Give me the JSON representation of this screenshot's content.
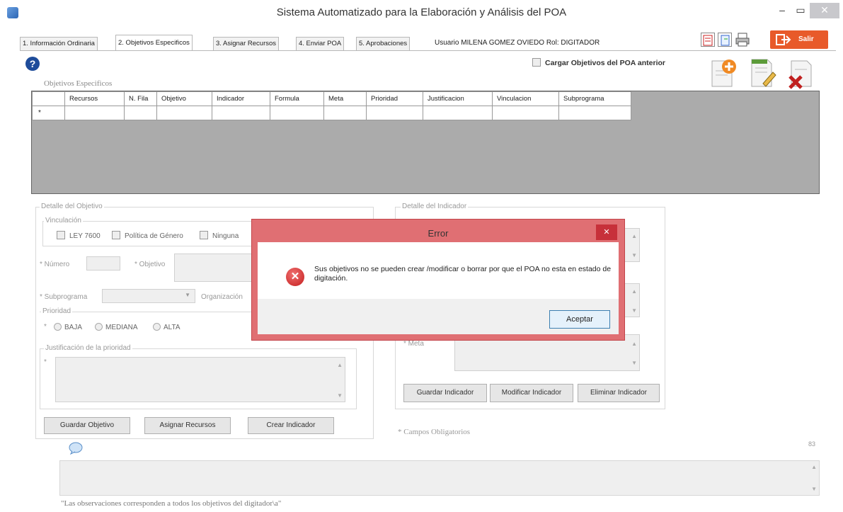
{
  "window": {
    "title": "Sistema Automatizado para la Elaboración y Análisis del POA",
    "minimize": "–",
    "maximize": "▭",
    "close": "✕"
  },
  "tabs": [
    {
      "label": "1. Información Ordinaria"
    },
    {
      "label": "2. Objetivos Especificos"
    },
    {
      "label": "3. Asignar Recursos"
    },
    {
      "label": "4. Enviar POA"
    },
    {
      "label": "5. Aprobaciones"
    }
  ],
  "user": {
    "text": "Usuario MILENA GOMEZ OVIEDO  Rol: DIGITADOR"
  },
  "exit_label": "Salir",
  "help_glyph": "?",
  "load_previous_label": "Cargar Objetivos del POA anterior",
  "grid": {
    "caption": "Objetivos Especificos",
    "columns": [
      "Recursos",
      "N. Fila",
      "Objetivo",
      "Indicador",
      "Formula",
      "Meta",
      "Prioridad",
      "Justificacion",
      "Vinculacion",
      "Subprograma"
    ],
    "new_row_marker": "*"
  },
  "objective_detail": {
    "caption": "Detalle del Objetivo",
    "vinculacion_caption": "Vinculación",
    "checks": [
      "LEY 7600",
      "Política de Género",
      "Ninguna"
    ],
    "numero_label": "* Número",
    "objetivo_label": "* Objetivo",
    "subprograma_label": "* Subprograma",
    "organizacion_label": "Organización",
    "prioridad_caption": "Prioridad",
    "required_mark": "*",
    "priorities": [
      "BAJA",
      "MEDIANA",
      "ALTA"
    ],
    "justificacion_caption": "Justificación de la prioridad",
    "buttons": [
      "Guardar Objetivo",
      "Asignar Recursos",
      "Crear Indicador"
    ]
  },
  "indicator_detail": {
    "caption": "Detalle del Indicador",
    "meta_label": "* Meta",
    "buttons": [
      "Guardar Indicador",
      "Modificar Indicador",
      "Eliminar Indicador"
    ]
  },
  "required_note": "* Campos Obligatorios",
  "char_counter": "83",
  "observations_note": "\"Las observaciones corresponden a todos los objetivos del digitador\\a\"",
  "dialog": {
    "title": "Error",
    "close": "✕",
    "message": "Sus objetivos no se pueden crear /modificar o borrar  por que el POA no esta en estado de digitación.",
    "icon_glyph": "✕",
    "accept": "Aceptar"
  },
  "colors": {
    "exit_button": "#e85a2a",
    "dialog_border": "#e06f73",
    "dialog_close": "#c7303a",
    "grid_background": "#ababab",
    "help_icon": "#1e4c9a"
  }
}
